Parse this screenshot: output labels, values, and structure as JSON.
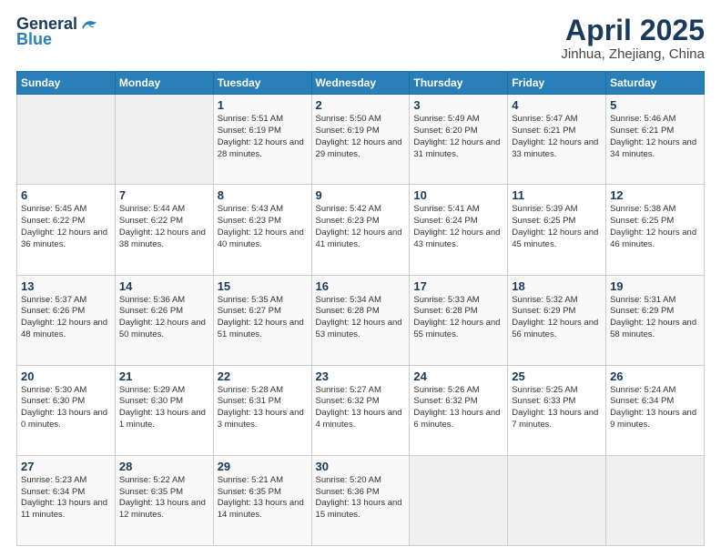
{
  "header": {
    "logo_general": "General",
    "logo_blue": "Blue",
    "title": "April 2025",
    "subtitle": "Jinhua, Zhejiang, China"
  },
  "days_of_week": [
    "Sunday",
    "Monday",
    "Tuesday",
    "Wednesday",
    "Thursday",
    "Friday",
    "Saturday"
  ],
  "weeks": [
    [
      {
        "day": "",
        "sunrise": "",
        "sunset": "",
        "daylight": ""
      },
      {
        "day": "",
        "sunrise": "",
        "sunset": "",
        "daylight": ""
      },
      {
        "day": "1",
        "sunrise": "Sunrise: 5:51 AM",
        "sunset": "Sunset: 6:19 PM",
        "daylight": "Daylight: 12 hours and 28 minutes."
      },
      {
        "day": "2",
        "sunrise": "Sunrise: 5:50 AM",
        "sunset": "Sunset: 6:19 PM",
        "daylight": "Daylight: 12 hours and 29 minutes."
      },
      {
        "day": "3",
        "sunrise": "Sunrise: 5:49 AM",
        "sunset": "Sunset: 6:20 PM",
        "daylight": "Daylight: 12 hours and 31 minutes."
      },
      {
        "day": "4",
        "sunrise": "Sunrise: 5:47 AM",
        "sunset": "Sunset: 6:21 PM",
        "daylight": "Daylight: 12 hours and 33 minutes."
      },
      {
        "day": "5",
        "sunrise": "Sunrise: 5:46 AM",
        "sunset": "Sunset: 6:21 PM",
        "daylight": "Daylight: 12 hours and 34 minutes."
      }
    ],
    [
      {
        "day": "6",
        "sunrise": "Sunrise: 5:45 AM",
        "sunset": "Sunset: 6:22 PM",
        "daylight": "Daylight: 12 hours and 36 minutes."
      },
      {
        "day": "7",
        "sunrise": "Sunrise: 5:44 AM",
        "sunset": "Sunset: 6:22 PM",
        "daylight": "Daylight: 12 hours and 38 minutes."
      },
      {
        "day": "8",
        "sunrise": "Sunrise: 5:43 AM",
        "sunset": "Sunset: 6:23 PM",
        "daylight": "Daylight: 12 hours and 40 minutes."
      },
      {
        "day": "9",
        "sunrise": "Sunrise: 5:42 AM",
        "sunset": "Sunset: 6:23 PM",
        "daylight": "Daylight: 12 hours and 41 minutes."
      },
      {
        "day": "10",
        "sunrise": "Sunrise: 5:41 AM",
        "sunset": "Sunset: 6:24 PM",
        "daylight": "Daylight: 12 hours and 43 minutes."
      },
      {
        "day": "11",
        "sunrise": "Sunrise: 5:39 AM",
        "sunset": "Sunset: 6:25 PM",
        "daylight": "Daylight: 12 hours and 45 minutes."
      },
      {
        "day": "12",
        "sunrise": "Sunrise: 5:38 AM",
        "sunset": "Sunset: 6:25 PM",
        "daylight": "Daylight: 12 hours and 46 minutes."
      }
    ],
    [
      {
        "day": "13",
        "sunrise": "Sunrise: 5:37 AM",
        "sunset": "Sunset: 6:26 PM",
        "daylight": "Daylight: 12 hours and 48 minutes."
      },
      {
        "day": "14",
        "sunrise": "Sunrise: 5:36 AM",
        "sunset": "Sunset: 6:26 PM",
        "daylight": "Daylight: 12 hours and 50 minutes."
      },
      {
        "day": "15",
        "sunrise": "Sunrise: 5:35 AM",
        "sunset": "Sunset: 6:27 PM",
        "daylight": "Daylight: 12 hours and 51 minutes."
      },
      {
        "day": "16",
        "sunrise": "Sunrise: 5:34 AM",
        "sunset": "Sunset: 6:28 PM",
        "daylight": "Daylight: 12 hours and 53 minutes."
      },
      {
        "day": "17",
        "sunrise": "Sunrise: 5:33 AM",
        "sunset": "Sunset: 6:28 PM",
        "daylight": "Daylight: 12 hours and 55 minutes."
      },
      {
        "day": "18",
        "sunrise": "Sunrise: 5:32 AM",
        "sunset": "Sunset: 6:29 PM",
        "daylight": "Daylight: 12 hours and 56 minutes."
      },
      {
        "day": "19",
        "sunrise": "Sunrise: 5:31 AM",
        "sunset": "Sunset: 6:29 PM",
        "daylight": "Daylight: 12 hours and 58 minutes."
      }
    ],
    [
      {
        "day": "20",
        "sunrise": "Sunrise: 5:30 AM",
        "sunset": "Sunset: 6:30 PM",
        "daylight": "Daylight: 13 hours and 0 minutes."
      },
      {
        "day": "21",
        "sunrise": "Sunrise: 5:29 AM",
        "sunset": "Sunset: 6:30 PM",
        "daylight": "Daylight: 13 hours and 1 minute."
      },
      {
        "day": "22",
        "sunrise": "Sunrise: 5:28 AM",
        "sunset": "Sunset: 6:31 PM",
        "daylight": "Daylight: 13 hours and 3 minutes."
      },
      {
        "day": "23",
        "sunrise": "Sunrise: 5:27 AM",
        "sunset": "Sunset: 6:32 PM",
        "daylight": "Daylight: 13 hours and 4 minutes."
      },
      {
        "day": "24",
        "sunrise": "Sunrise: 5:26 AM",
        "sunset": "Sunset: 6:32 PM",
        "daylight": "Daylight: 13 hours and 6 minutes."
      },
      {
        "day": "25",
        "sunrise": "Sunrise: 5:25 AM",
        "sunset": "Sunset: 6:33 PM",
        "daylight": "Daylight: 13 hours and 7 minutes."
      },
      {
        "day": "26",
        "sunrise": "Sunrise: 5:24 AM",
        "sunset": "Sunset: 6:34 PM",
        "daylight": "Daylight: 13 hours and 9 minutes."
      }
    ],
    [
      {
        "day": "27",
        "sunrise": "Sunrise: 5:23 AM",
        "sunset": "Sunset: 6:34 PM",
        "daylight": "Daylight: 13 hours and 11 minutes."
      },
      {
        "day": "28",
        "sunrise": "Sunrise: 5:22 AM",
        "sunset": "Sunset: 6:35 PM",
        "daylight": "Daylight: 13 hours and 12 minutes."
      },
      {
        "day": "29",
        "sunrise": "Sunrise: 5:21 AM",
        "sunset": "Sunset: 6:35 PM",
        "daylight": "Daylight: 13 hours and 14 minutes."
      },
      {
        "day": "30",
        "sunrise": "Sunrise: 5:20 AM",
        "sunset": "Sunset: 6:36 PM",
        "daylight": "Daylight: 13 hours and 15 minutes."
      },
      {
        "day": "",
        "sunrise": "",
        "sunset": "",
        "daylight": ""
      },
      {
        "day": "",
        "sunrise": "",
        "sunset": "",
        "daylight": ""
      },
      {
        "day": "",
        "sunrise": "",
        "sunset": "",
        "daylight": ""
      }
    ]
  ]
}
